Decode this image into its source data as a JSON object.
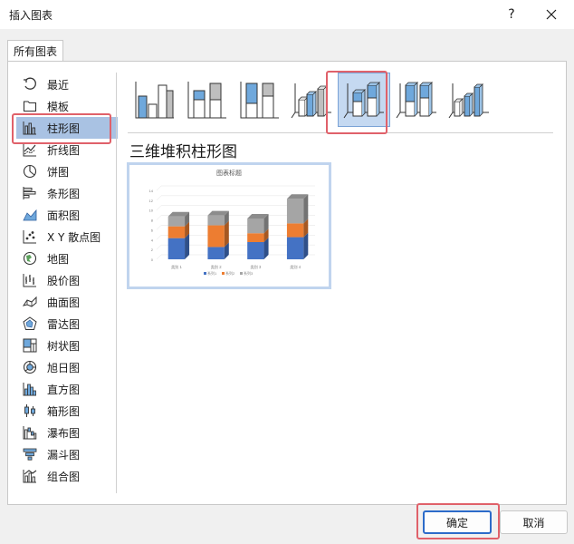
{
  "window": {
    "title": "插入图表",
    "help_label": "?"
  },
  "tabs": [
    {
      "label": "所有图表"
    }
  ],
  "sidebar": {
    "items": [
      {
        "label": "最近",
        "icon": "recent-icon"
      },
      {
        "label": "模板",
        "icon": "folder-icon"
      },
      {
        "label": "柱形图",
        "icon": "column-chart-icon",
        "selected": true
      },
      {
        "label": "折线图",
        "icon": "line-chart-icon"
      },
      {
        "label": "饼图",
        "icon": "pie-chart-icon"
      },
      {
        "label": "条形图",
        "icon": "bar-chart-icon"
      },
      {
        "label": "面积图",
        "icon": "area-chart-icon"
      },
      {
        "label": "X Y 散点图",
        "icon": "scatter-chart-icon"
      },
      {
        "label": "地图",
        "icon": "map-chart-icon"
      },
      {
        "label": "股价图",
        "icon": "stock-chart-icon"
      },
      {
        "label": "曲面图",
        "icon": "surface-chart-icon"
      },
      {
        "label": "雷达图",
        "icon": "radar-chart-icon"
      },
      {
        "label": "树状图",
        "icon": "treemap-chart-icon"
      },
      {
        "label": "旭日图",
        "icon": "sunburst-chart-icon"
      },
      {
        "label": "直方图",
        "icon": "histogram-chart-icon"
      },
      {
        "label": "箱形图",
        "icon": "box-whisker-chart-icon"
      },
      {
        "label": "瀑布图",
        "icon": "waterfall-chart-icon"
      },
      {
        "label": "漏斗图",
        "icon": "funnel-chart-icon"
      },
      {
        "label": "组合图",
        "icon": "combo-chart-icon"
      }
    ]
  },
  "subtypes": {
    "selected_index": 4,
    "selected_title": "三维堆积柱形图"
  },
  "preview": {
    "chart_title": "图表标题"
  },
  "buttons": {
    "ok_label": "确定",
    "cancel_label": "取消"
  },
  "colors": {
    "accent": "#2c6bc9",
    "selection_bg": "#a9c2e3",
    "highlight_border": "#e0616a",
    "series1": "#4472c4",
    "series2": "#ed7d31",
    "series3": "#a5a5a5"
  },
  "chart_data": {
    "type": "bar",
    "title": "图表标题",
    "categories": [
      "类别 1",
      "类别 2",
      "类别 3",
      "类别 4"
    ],
    "series": [
      {
        "name": "系列1",
        "values": [
          4.3,
          2.5,
          3.5,
          4.5
        ]
      },
      {
        "name": "系列2",
        "values": [
          2.4,
          4.4,
          1.8,
          2.8
        ]
      },
      {
        "name": "系列3",
        "values": [
          2,
          2,
          3,
          5
        ]
      }
    ],
    "ylim": [
      0,
      14
    ],
    "yticks": [
      "0",
      "2",
      "4",
      "6",
      "8",
      "10",
      "12",
      "14"
    ],
    "stacked": true,
    "three_d": true,
    "legend": "bottom"
  }
}
